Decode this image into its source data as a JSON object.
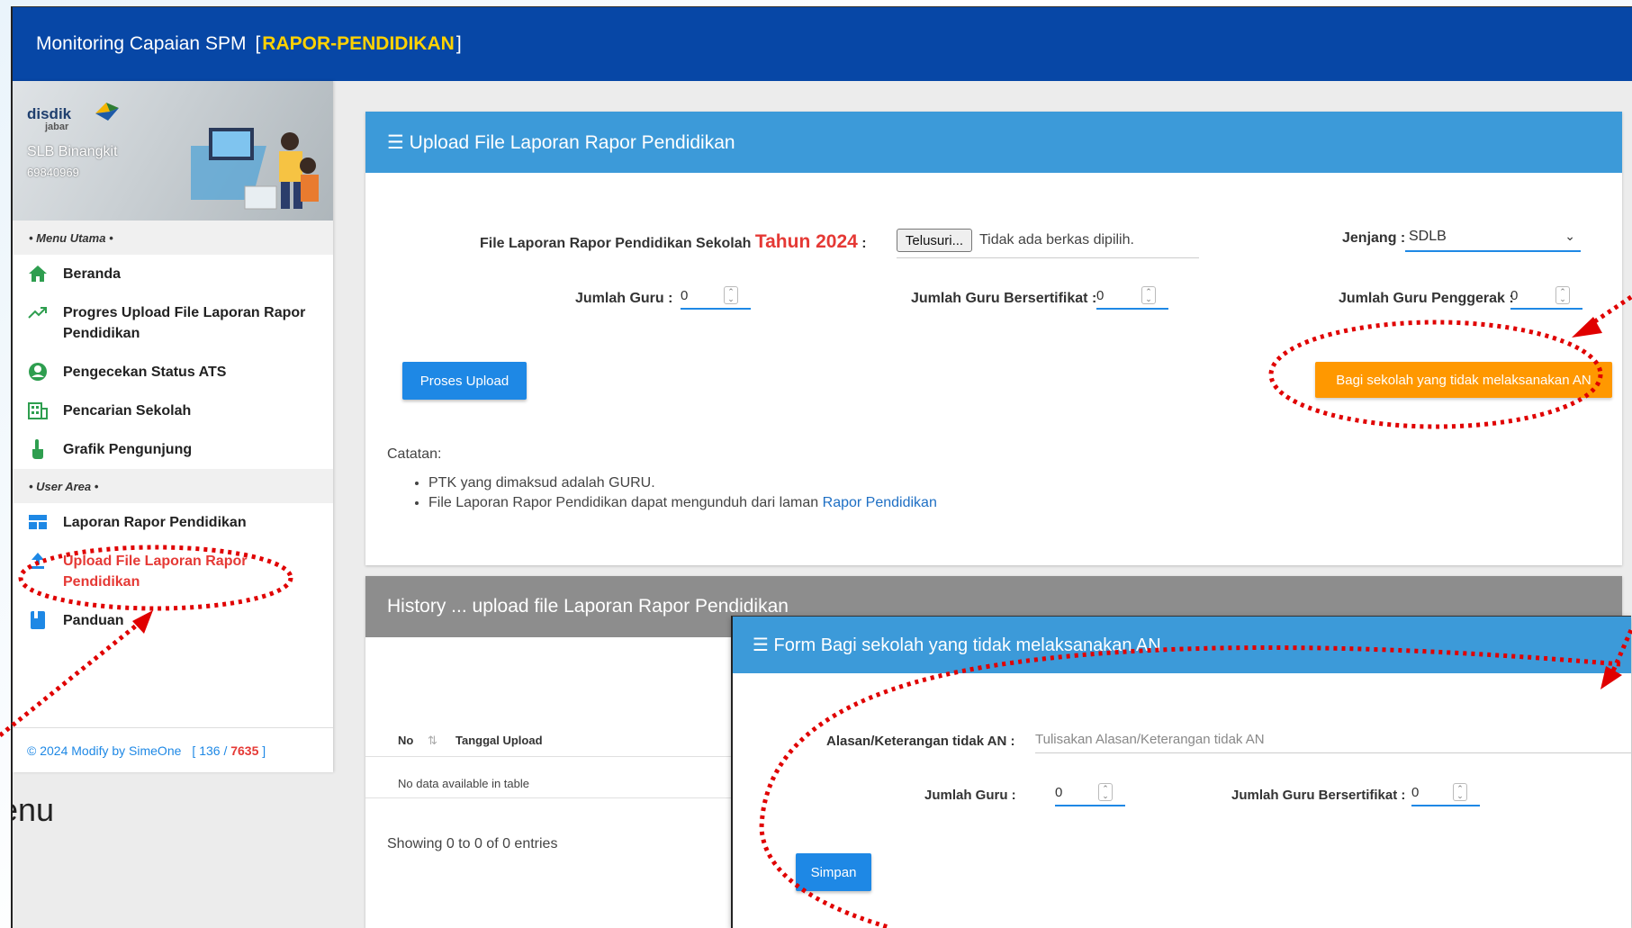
{
  "header": {
    "title": "Monitoring Capaian SPM",
    "tag_open": "[",
    "tag": "RAPOR-PENDIDIKAN",
    "tag_close": "]"
  },
  "profile": {
    "logo_top": "disdik",
    "logo_bottom": "jabar",
    "school_name": "SLB Binangkit",
    "npsn": "69840969"
  },
  "sidebar": {
    "section_main": "• Menu Utama •",
    "main_items": [
      {
        "label": "Beranda",
        "icon": "home-icon"
      },
      {
        "label": "Progres Upload File Laporan Rapor Pendidikan",
        "icon": "trending-up-icon"
      },
      {
        "label": "Pengecekan Status ATS",
        "icon": "user-circle-icon"
      },
      {
        "label": "Pencarian Sekolah",
        "icon": "building-icon"
      },
      {
        "label": "Grafik Pengunjung",
        "icon": "pointer-hand-icon"
      }
    ],
    "section_user": "• User Area •",
    "user_items": [
      {
        "label": "Laporan Rapor Pendidikan",
        "icon": "table-icon"
      },
      {
        "label": "Upload File Laporan Rapor Pendidikan",
        "icon": "upload-icon"
      },
      {
        "label": "Panduan",
        "icon": "book-icon"
      }
    ],
    "footer_text": "© 2024 Modify by SimeOne",
    "counter_open": "[",
    "counter_today": "136",
    "counter_sep": "/",
    "counter_total": "7635",
    "counter_close": "]"
  },
  "upload_card": {
    "title": "☰ Upload File Laporan Rapor Pendidikan",
    "file_label": "File Laporan Rapor Pendidikan Sekolah",
    "year_label": "Tahun 2024",
    "colon": ":",
    "browse_button": "Telusuri...",
    "file_status": "Tidak ada berkas dipilih.",
    "jenjang_label": "Jenjang :",
    "jenjang_value": "SDLB",
    "jumlah_guru_label": "Jumlah Guru :",
    "jumlah_guru_value": "0",
    "guru_sertifikat_label": "Jumlah Guru Bersertifikat :",
    "guru_sertifikat_value": "0",
    "guru_penggerak_label": "Jumlah Guru Penggerak :",
    "guru_penggerak_value": "0",
    "upload_button": "Proses Upload",
    "no_an_button": "Bagi sekolah yang tidak melaksanakan AN",
    "notes_title": "Catatan:",
    "note_1": "PTK yang dimaksud adalah GURU.",
    "note_2_text": "File Laporan Rapor Pendidikan dapat mengunduh dari laman",
    "note_2_link": "Rapor Pendidikan"
  },
  "history_card": {
    "title": "History ... upload file Laporan Rapor Pendidikan",
    "col_no": "No",
    "col_date": "Tanggal Upload",
    "empty_text": "No data available in table",
    "showing_text": "Showing 0 to 0 of 0 entries"
  },
  "form_card": {
    "title": "☰ Form Bagi sekolah yang tidak melaksanakan AN",
    "reason_label": "Alasan/Keterangan tidak AN :",
    "reason_placeholder": "Tulisakan Alasan/Keterangan tidak AN",
    "jumlah_guru_label": "Jumlah Guru :",
    "jumlah_guru_value": "0",
    "guru_sertifikat_label": "Jumlah Guru Bersertifikat :",
    "guru_sertifikat_value": "0",
    "save_button": "Simpan"
  },
  "outside_text": "enu",
  "colors": {
    "topbar": "#0747a6",
    "card_header": "#3c9ad9",
    "history_header": "#8d8d8d",
    "primary_button": "#1e88e5",
    "orange_button": "#ff9800",
    "highlight_red": "#e53935",
    "tag_yellow": "#ffd200"
  }
}
